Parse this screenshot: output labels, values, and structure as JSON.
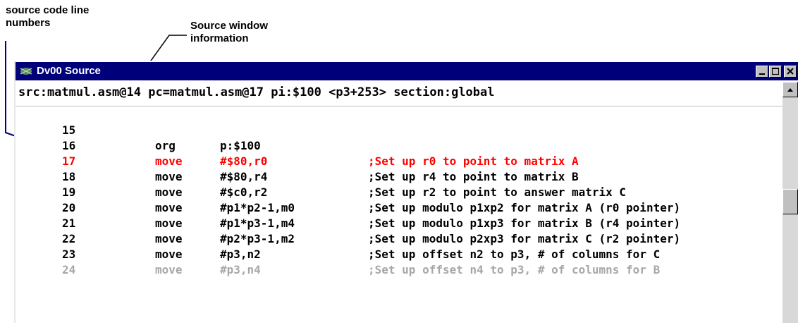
{
  "annotations": {
    "line_numbers_label": "source code line\nnumbers",
    "window_info_label": "Source window\ninformation"
  },
  "window": {
    "title": "Dv00 Source",
    "controls": [
      "minimize-icon",
      "maximize-icon",
      "close-icon"
    ],
    "titlebar_color": "#00007b",
    "highlight_color": "#ff0000"
  },
  "info_bar": "src:matmul.asm@14 pc=matmul.asm@17 pi:$100 <p3+253> section:global",
  "source_lines": [
    {
      "num": "15",
      "op": "",
      "arg": "",
      "comment": ""
    },
    {
      "num": "16",
      "op": "org",
      "arg": "p:$100",
      "comment": ""
    },
    {
      "num": "17",
      "op": "move",
      "arg": "#$80,r0",
      "comment": ";Set up r0 to point to matrix A"
    },
    {
      "num": "18",
      "op": "move",
      "arg": "#$80,r4",
      "comment": ";Set up r4 to point to matrix B"
    },
    {
      "num": "19",
      "op": "move",
      "arg": "#$c0,r2",
      "comment": ";Set up r2 to point to answer matrix C"
    },
    {
      "num": "20",
      "op": "move",
      "arg": "#p1*p2-1,m0",
      "comment": ";Set up modulo p1xp2 for matrix A (r0 pointer)"
    },
    {
      "num": "21",
      "op": "move",
      "arg": "#p1*p3-1,m4",
      "comment": ";Set up modulo p1xp3 for matrix B (r4 pointer)"
    },
    {
      "num": "22",
      "op": "move",
      "arg": "#p2*p3-1,m2",
      "comment": ";Set up modulo p2xp3 for matrix C (r2 pointer)"
    },
    {
      "num": "23",
      "op": "move",
      "arg": "#p3,n2",
      "comment": ";Set up offset n2 to p3, # of columns for C"
    },
    {
      "num": "24",
      "op": "move",
      "arg": "#p3,n4",
      "comment": ";Set up offset n4 to p3, # of columns for B"
    }
  ]
}
